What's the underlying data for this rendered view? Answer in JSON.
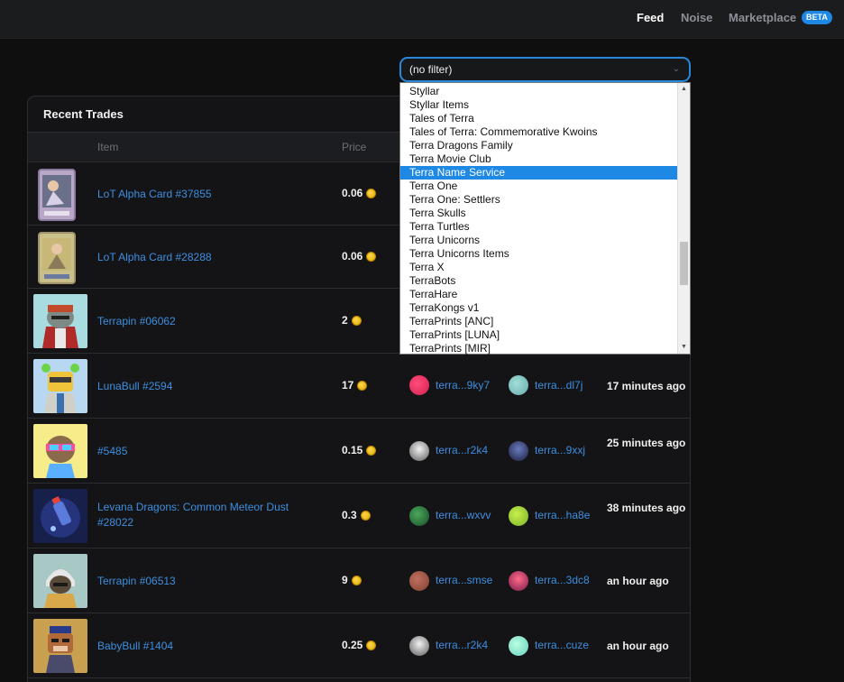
{
  "nav": {
    "feed": "Feed",
    "noise": "Noise",
    "marketplace": "Marketplace",
    "beta": "BETA"
  },
  "filter": {
    "value": "(no filter)"
  },
  "trades": {
    "title": "Recent Trades",
    "columns": {
      "item": "Item",
      "price": "Price"
    },
    "rows": [
      {
        "item": "LoT Alpha Card #37855",
        "price": "0.06",
        "seller": "",
        "buyer": "",
        "time": ""
      },
      {
        "item": "LoT Alpha Card #28288",
        "price": "0.06",
        "seller": "",
        "buyer": "",
        "time": ""
      },
      {
        "item": "Terrapin #06062",
        "price": "2",
        "seller": "",
        "buyer": "",
        "time": ""
      },
      {
        "item": "LunaBull #2594",
        "price": "17",
        "seller": "terra...9ky7",
        "buyer": "terra...dl7j",
        "time": "17 minutes ago"
      },
      {
        "item": "#5485",
        "price": "0.15",
        "seller": "terra...r2k4",
        "buyer": "terra...9xxj",
        "time": "25 minutes ago"
      },
      {
        "item": "Levana Dragons: Common Meteor Dust #28022",
        "price": "0.3",
        "seller": "terra...wxvv",
        "buyer": "terra...ha8e",
        "time": "38 minutes ago"
      },
      {
        "item": "Terrapin #06513",
        "price": "9",
        "seller": "terra...smse",
        "buyer": "terra...3dc8",
        "time": "an hour ago"
      },
      {
        "item": "BabyBull #1404",
        "price": "0.25",
        "seller": "terra...r2k4",
        "buyer": "terra...cuze",
        "time": "an hour ago"
      }
    ]
  },
  "dropdown": {
    "selected": "Terra Name Service",
    "options": [
      "Styllar",
      "Styllar Items",
      "Tales of Terra",
      "Tales of Terra: Commemorative Kwoins",
      "Terra Dragons Family",
      "Terra Movie Club",
      "Terra Name Service",
      "Terra One",
      "Terra One: Settlers",
      "Terra Skulls",
      "Terra Turtles",
      "Terra Unicorns",
      "Terra Unicorns Items",
      "Terra X",
      "TerraBots",
      "TerraHare",
      "TerraKongs v1",
      "TerraPrints [ANC]",
      "TerraPrints [LUNA]",
      "TerraPrints [MIR]"
    ]
  },
  "icons": {
    "coin": "luna-coin-icon",
    "chevron": "chevron-down-icon"
  },
  "colors": {
    "accent": "#1e88e5",
    "link": "#3d8fe0",
    "background": "#0f0f10"
  }
}
